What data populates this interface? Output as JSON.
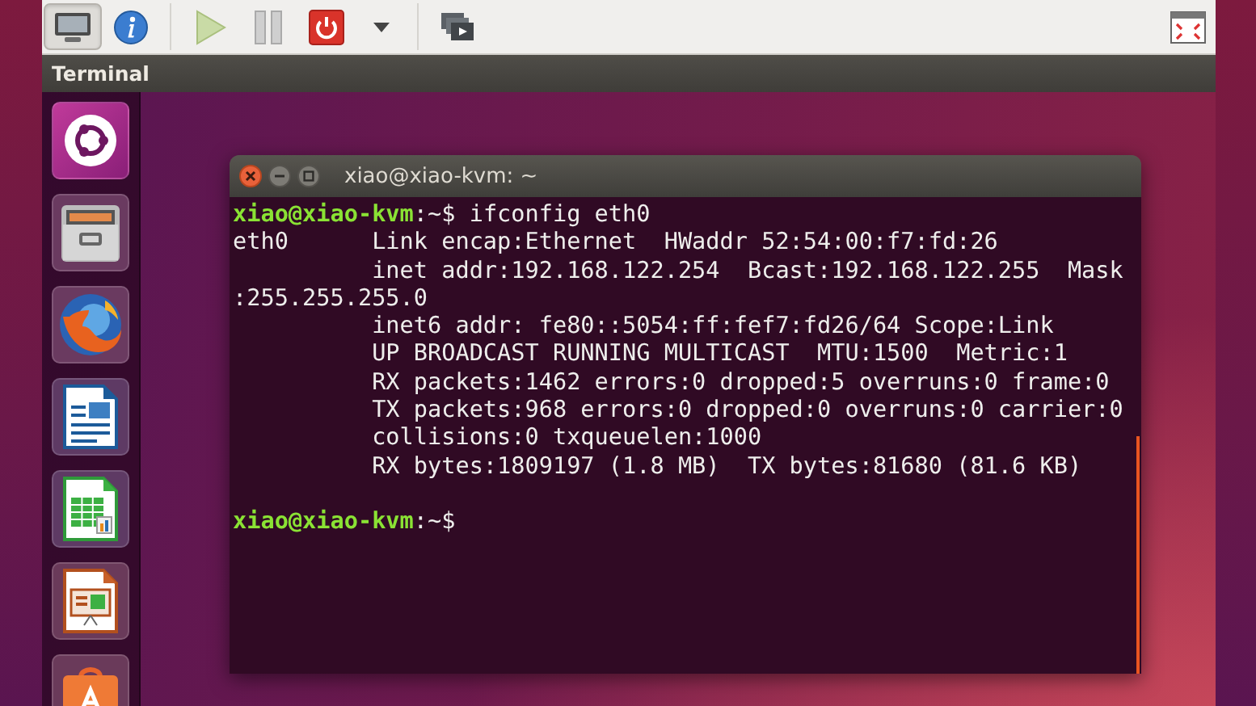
{
  "host_toolbar": {
    "groups": [
      {
        "buttons": [
          {
            "kind": "console",
            "selected": true
          },
          {
            "kind": "info",
            "selected": false
          }
        ]
      },
      {
        "buttons": [
          {
            "kind": "run",
            "selected": false
          },
          {
            "kind": "pause",
            "selected": false
          },
          {
            "kind": "shutdown",
            "selected": false
          },
          {
            "kind": "menu",
            "selected": false
          }
        ]
      },
      {
        "buttons": [
          {
            "kind": "screens",
            "selected": false
          }
        ]
      },
      {
        "buttons": [
          {
            "kind": "fullscreen",
            "selected": false
          }
        ]
      }
    ]
  },
  "console_bar": {
    "title": "Terminal"
  },
  "launcher": [
    {
      "kind": "dash"
    },
    {
      "kind": "files"
    },
    {
      "kind": "browser"
    },
    {
      "kind": "writer"
    },
    {
      "kind": "calc"
    },
    {
      "kind": "impress"
    },
    {
      "kind": "store"
    }
  ],
  "terminal": {
    "title": "xiao@xiao-kvm: ~",
    "lines": [
      {
        "kind": "prompt",
        "user_host": "xiao@xiao-kvm",
        "prompt_end": ":~$",
        "command": "ifconfig eth0"
      },
      {
        "kind": "output",
        "text": "eth0      Link encap:Ethernet  HWaddr 52:54:00:f7:fd:26"
      },
      {
        "kind": "output",
        "text": "          inet addr:192.168.122.254  Bcast:192.168.122.255  Mask"
      },
      {
        "kind": "output",
        "text": ":255.255.255.0"
      },
      {
        "kind": "output",
        "text": "          inet6 addr: fe80::5054:ff:fef7:fd26/64 Scope:Link"
      },
      {
        "kind": "output",
        "text": "          UP BROADCAST RUNNING MULTICAST  MTU:1500  Metric:1"
      },
      {
        "kind": "output",
        "text": "          RX packets:1462 errors:0 dropped:5 overruns:0 frame:0"
      },
      {
        "kind": "output",
        "text": "          TX packets:968 errors:0 dropped:0 overruns:0 carrier:0"
      },
      {
        "kind": "output",
        "text": "          collisions:0 txqueuelen:1000"
      },
      {
        "kind": "output",
        "text": "          RX bytes:1809197 (1.8 MB)  TX bytes:81680 (81.6 KB)"
      },
      {
        "kind": "blank"
      },
      {
        "kind": "prompt",
        "user_host": "xiao@xiao-kvm",
        "prompt_end": ":~$"
      }
    ]
  }
}
